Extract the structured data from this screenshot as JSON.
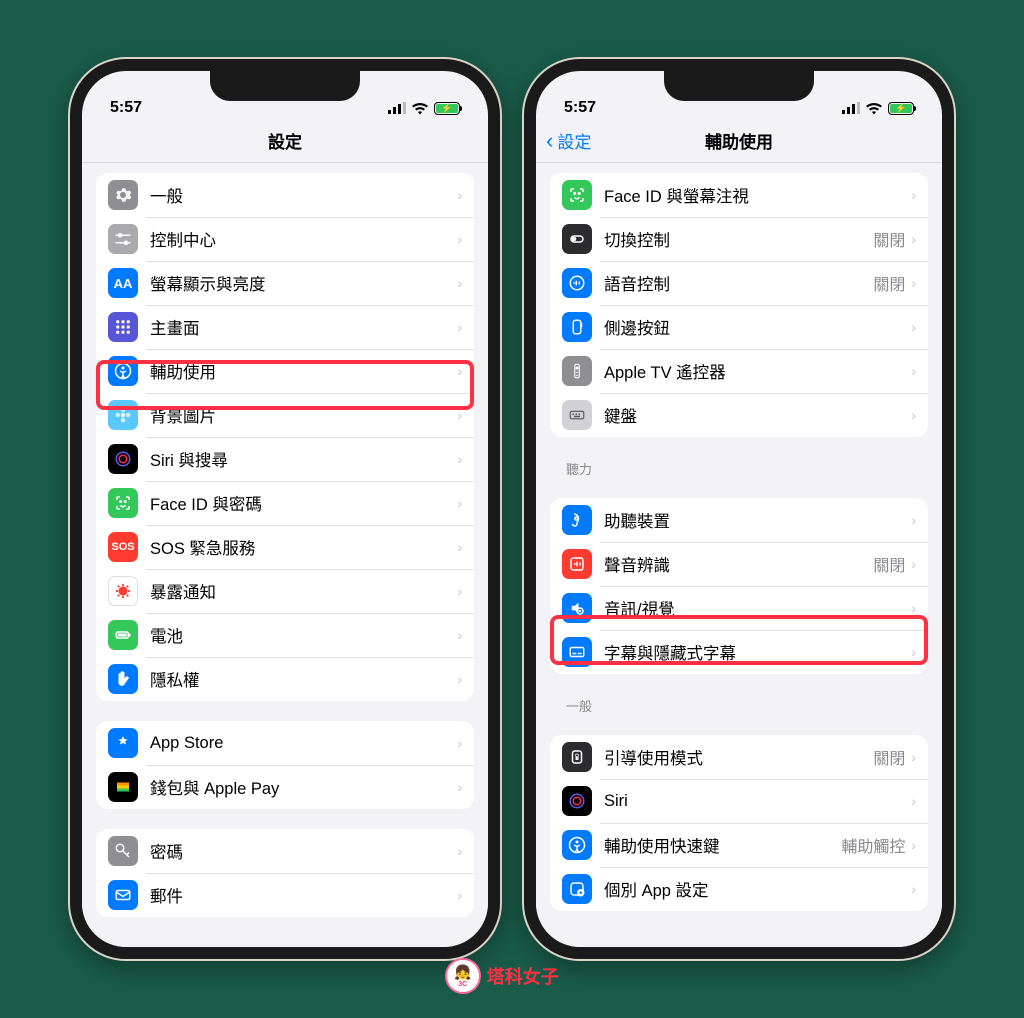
{
  "status": {
    "time": "5:57"
  },
  "watermark": {
    "text": "塔科女子",
    "badge": "3C"
  },
  "left": {
    "title": "設定",
    "groups": [
      {
        "rows": [
          {
            "name": "general",
            "label": "一般",
            "icon": "gear-icon",
            "bg": "bg-gray"
          },
          {
            "name": "control-center",
            "label": "控制中心",
            "icon": "sliders-icon",
            "bg": "bg-gray2"
          },
          {
            "name": "display",
            "label": "螢幕顯示與亮度",
            "icon": "aa-icon",
            "bg": "bg-blue"
          },
          {
            "name": "home-screen",
            "label": "主畫面",
            "icon": "grid-icon",
            "bg": "bg-purple"
          },
          {
            "name": "accessibility",
            "label": "輔助使用",
            "icon": "person-icon",
            "bg": "bg-blue",
            "highlight": true
          },
          {
            "name": "wallpaper",
            "label": "背景圖片",
            "icon": "flower-icon",
            "bg": "bg-teal"
          },
          {
            "name": "siri",
            "label": "Siri 與搜尋",
            "icon": "siri-icon",
            "bg": "bg-black"
          },
          {
            "name": "faceid",
            "label": "Face ID 與密碼",
            "icon": "faceid-icon",
            "bg": "bg-green"
          },
          {
            "name": "sos",
            "label": "SOS 緊急服務",
            "icon": "sos-icon",
            "bg": "bg-red"
          },
          {
            "name": "exposure",
            "label": "暴露通知",
            "icon": "virus-icon",
            "bg": "bg-white"
          },
          {
            "name": "battery",
            "label": "電池",
            "icon": "battery-icon",
            "bg": "bg-green"
          },
          {
            "name": "privacy",
            "label": "隱私權",
            "icon": "hand-icon",
            "bg": "bg-blue"
          }
        ]
      },
      {
        "rows": [
          {
            "name": "app-store",
            "label": "App Store",
            "icon": "appstore-icon",
            "bg": "bg-blue"
          },
          {
            "name": "wallet",
            "label": "錢包與 Apple Pay",
            "icon": "wallet-icon",
            "bg": "bg-black"
          }
        ]
      },
      {
        "rows": [
          {
            "name": "passwords",
            "label": "密碼",
            "icon": "key-icon",
            "bg": "bg-gray"
          },
          {
            "name": "mail",
            "label": "郵件",
            "icon": "mail-icon",
            "bg": "bg-blue"
          }
        ]
      }
    ]
  },
  "right": {
    "back": "設定",
    "title": "輔助使用",
    "groups": [
      {
        "rows": [
          {
            "name": "faceid-attention",
            "label": "Face ID 與螢幕注視",
            "icon": "faceid-icon",
            "bg": "bg-green"
          },
          {
            "name": "switch-control",
            "label": "切換控制",
            "icon": "switch-icon",
            "bg": "bg-dark",
            "value": "關閉"
          },
          {
            "name": "voice-control",
            "label": "語音控制",
            "icon": "voice-icon",
            "bg": "bg-blue",
            "value": "關閉"
          },
          {
            "name": "side-button",
            "label": "側邊按鈕",
            "icon": "side-icon",
            "bg": "bg-blue"
          },
          {
            "name": "apple-tv-remote",
            "label": "Apple TV 遙控器",
            "icon": "remote-icon",
            "bg": "bg-gray"
          },
          {
            "name": "keyboards",
            "label": "鍵盤",
            "icon": "keyboard-icon",
            "bg": "bg-lgray"
          }
        ]
      },
      {
        "header": "聽力",
        "rows": [
          {
            "name": "hearing-devices",
            "label": "助聽裝置",
            "icon": "ear-icon",
            "bg": "bg-blue"
          },
          {
            "name": "sound-recog",
            "label": "聲音辨識",
            "icon": "sound-icon",
            "bg": "bg-red",
            "value": "關閉"
          },
          {
            "name": "audio-visual",
            "label": "音訊/視覺",
            "icon": "av-icon",
            "bg": "bg-blue",
            "highlight": true
          },
          {
            "name": "subtitles",
            "label": "字幕與隱藏式字幕",
            "icon": "subtitle-icon",
            "bg": "bg-blue"
          }
        ]
      },
      {
        "header": "一般",
        "rows": [
          {
            "name": "guided-access",
            "label": "引導使用模式",
            "icon": "lock-icon",
            "bg": "bg-dark",
            "value": "關閉"
          },
          {
            "name": "siri-a11y",
            "label": "Siri",
            "icon": "siri-icon",
            "bg": "bg-black"
          },
          {
            "name": "shortcut",
            "label": "輔助使用快速鍵",
            "icon": "person-icon",
            "bg": "bg-blue",
            "value": "輔助觸控"
          },
          {
            "name": "per-app",
            "label": "個別 App 設定",
            "icon": "app-set-icon",
            "bg": "bg-blue"
          }
        ]
      }
    ]
  }
}
